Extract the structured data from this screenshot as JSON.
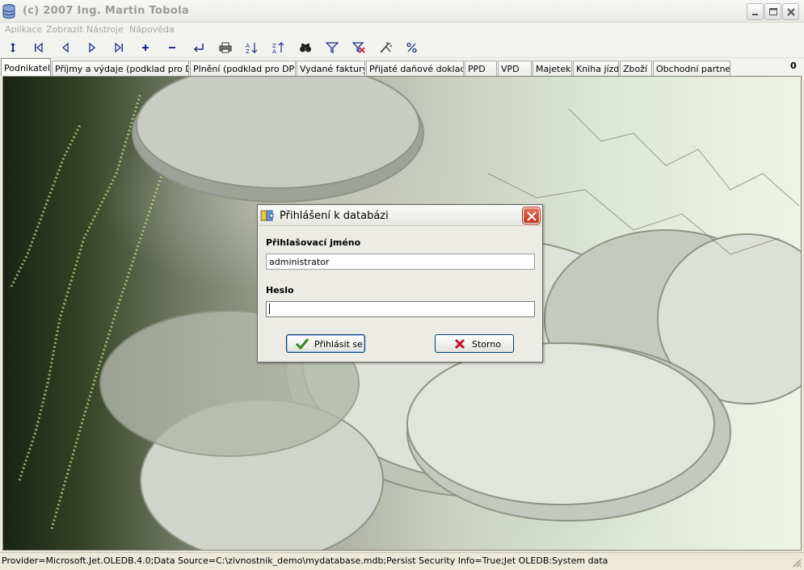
{
  "window": {
    "title": "(c) 2007  Ing. Martin Tobola"
  },
  "menu": {
    "items": [
      "Aplikace",
      "Zobrazit",
      "Nástroje",
      "Nápověda"
    ]
  },
  "toolbar": {
    "icons": [
      "refresh-icon",
      "first-record-icon",
      "previous-record-icon",
      "next-record-icon",
      "last-record-icon",
      "add-record-icon",
      "delete-record-icon",
      "enter-icon",
      "print-icon",
      "sort-ascending-icon",
      "sort-descending-icon",
      "find-icon",
      "filter-icon",
      "remove-filter-icon",
      "tools-icon",
      "percent-icon"
    ]
  },
  "tabs": {
    "items": [
      "Podnikatel",
      "Příjmy a výdaje (podklad pro DzP)",
      "Plnění (podklad pro DPH)",
      "Vydané faktury",
      "Přijaté daňové doklady",
      "PPD",
      "VPD",
      "Majetek",
      "Kniha jízd",
      "Zboží",
      "Obchodní partneři"
    ],
    "active": "Podnikatel",
    "counter": "0"
  },
  "dialog": {
    "title": "Přihlášení k databázi",
    "username_label": "Přihlašovací jméno",
    "username_value": "administrator",
    "password_label": "Heslo",
    "password_value": "",
    "login_button": "Přihlásit se",
    "cancel_button": "Storno"
  },
  "status": {
    "text": "Provider=Microsoft.Jet.OLEDB.4.0;Data Source=C:\\zivnostnik_demo\\mydatabase.mdb;Persist Security Info=True;Jet OLEDB:System data"
  },
  "colors": {
    "navy_icon": "#1f2d8a",
    "ok_check": "#2e8b1e",
    "cancel_x": "#c8102e",
    "close_red": "#c0331a"
  }
}
